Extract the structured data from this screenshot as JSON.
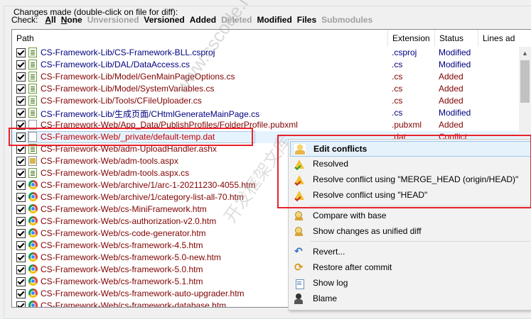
{
  "groupbox_title": "Changes made (double-click on file for diff):",
  "checkbar": {
    "label": "Check:",
    "buttons": [
      {
        "label": "All",
        "enabled": true,
        "underline": true
      },
      {
        "label": "None",
        "enabled": true,
        "underline": true
      },
      {
        "label": "Unversioned",
        "enabled": false
      },
      {
        "label": "Versioned",
        "enabled": true
      },
      {
        "label": "Added",
        "enabled": true
      },
      {
        "label": "Deleted",
        "enabled": false
      },
      {
        "label": "Modified",
        "enabled": true
      },
      {
        "label": "Files",
        "enabled": true
      },
      {
        "label": "Submodules",
        "enabled": false
      }
    ]
  },
  "columns": [
    "Path",
    "Extension",
    "Status",
    "Lines ad"
  ],
  "files": [
    {
      "path": "CS-Framework-Lib/CS-Framework-BLL.csproj",
      "ext": ".csproj",
      "status": "Modified",
      "icon": "doc-icon"
    },
    {
      "path": "CS-Framework-Lib/DAL/DataAccess.cs",
      "ext": ".cs",
      "status": "Modified",
      "icon": "doc-icon"
    },
    {
      "path": "CS-Framework-Lib/Model/GenMainPageOptions.cs",
      "ext": ".cs",
      "status": "Added",
      "icon": "doc-icon"
    },
    {
      "path": "CS-Framework-Lib/Model/SystemVariables.cs",
      "ext": ".cs",
      "status": "Added",
      "icon": "doc-icon"
    },
    {
      "path": "CS-Framework-Lib/Tools/CFileUploader.cs",
      "ext": ".cs",
      "status": "Added",
      "icon": "doc-icon"
    },
    {
      "path": "CS-Framework-Lib/生成页面/CHtmlGenerateMainPage.cs",
      "ext": ".cs",
      "status": "Modified",
      "icon": "doc-icon"
    },
    {
      "path": "CS-Framework-Web/App_Data/PublishProfiles/FolderProfile.pubxml",
      "ext": ".pubxml",
      "status": "Added",
      "icon": "plain-file-icon"
    },
    {
      "path": "CS-Framework-Web/_private/default-temp.dat",
      "ext": ".dat",
      "status": "Conflict",
      "icon": "plain-file-icon"
    },
    {
      "path": "CS-Framework-Web/adm-UploadHandler.ashx",
      "ext": "",
      "status": "",
      "icon": "doc-icon"
    },
    {
      "path": "CS-Framework-Web/adm-tools.aspx",
      "ext": "",
      "status": "",
      "icon": "aspx-file-icon"
    },
    {
      "path": "CS-Framework-Web/adm-tools.aspx.cs",
      "ext": "",
      "status": "",
      "icon": "doc-icon"
    },
    {
      "path": "CS-Framework-Web/archive/1/arc-1-20211230-4055.htm",
      "ext": "",
      "status": "",
      "icon": "chrome-icon"
    },
    {
      "path": "CS-Framework-Web/archive/1/category-list-all-70.htm",
      "ext": "",
      "status": "",
      "icon": "chrome-icon"
    },
    {
      "path": "CS-Framework-Web/cs-MiniFramework.htm",
      "ext": "",
      "status": "",
      "icon": "chrome-icon"
    },
    {
      "path": "CS-Framework-Web/cs-authorization-v2.0.htm",
      "ext": "",
      "status": "",
      "icon": "chrome-icon"
    },
    {
      "path": "CS-Framework-Web/cs-code-generator.htm",
      "ext": "",
      "status": "",
      "icon": "chrome-icon"
    },
    {
      "path": "CS-Framework-Web/cs-framework-4.5.htm",
      "ext": "",
      "status": "",
      "icon": "chrome-icon"
    },
    {
      "path": "CS-Framework-Web/cs-framework-5.0-new.htm",
      "ext": "",
      "status": "",
      "icon": "chrome-icon"
    },
    {
      "path": "CS-Framework-Web/cs-framework-5.0.htm",
      "ext": "",
      "status": "",
      "icon": "chrome-icon"
    },
    {
      "path": "CS-Framework-Web/cs-framework-5.1.htm",
      "ext": "",
      "status": "",
      "icon": "chrome-icon"
    },
    {
      "path": "CS-Framework-Web/cs-framework-auto-upgrader.htm",
      "ext": "",
      "status": "",
      "icon": "chrome-icon"
    },
    {
      "path": "CS-Framework-Web/cs-framework-database.htm",
      "ext": "",
      "status": "",
      "icon": "chrome-icon"
    }
  ],
  "context_menu": {
    "items": [
      {
        "label": "Edit conflicts",
        "icon": "edit-conflicts-icon",
        "bold": true,
        "highlight": true
      },
      {
        "label": "Resolved",
        "icon": "resolved-icon"
      },
      {
        "label": "Resolve conflict using \"MERGE_HEAD (origin/HEAD)\"",
        "icon": "resolve-theirs-icon"
      },
      {
        "label": "Resolve conflict using \"HEAD\"",
        "icon": "resolve-mine-icon"
      },
      {
        "label": "Compare with base",
        "icon": "compare-icon"
      },
      {
        "label": "Show changes as unified diff",
        "icon": "unified-diff-icon"
      },
      {
        "label": "Revert...",
        "icon": "revert-icon"
      },
      {
        "label": "Restore after commit",
        "icon": "restore-icon"
      },
      {
        "label": "Show log",
        "icon": "log-icon"
      },
      {
        "label": "Blame",
        "icon": "blame-icon"
      }
    ]
  },
  "watermark": {
    "line1": "www.cscode.net",
    "line2": "开发框架文库"
  },
  "colors": {
    "status_added": "#800000",
    "status_modified": "#000080",
    "status_conflict": "#c00000",
    "annotation_red": "#e8222b",
    "menu_highlight": "#e5f1fb"
  }
}
